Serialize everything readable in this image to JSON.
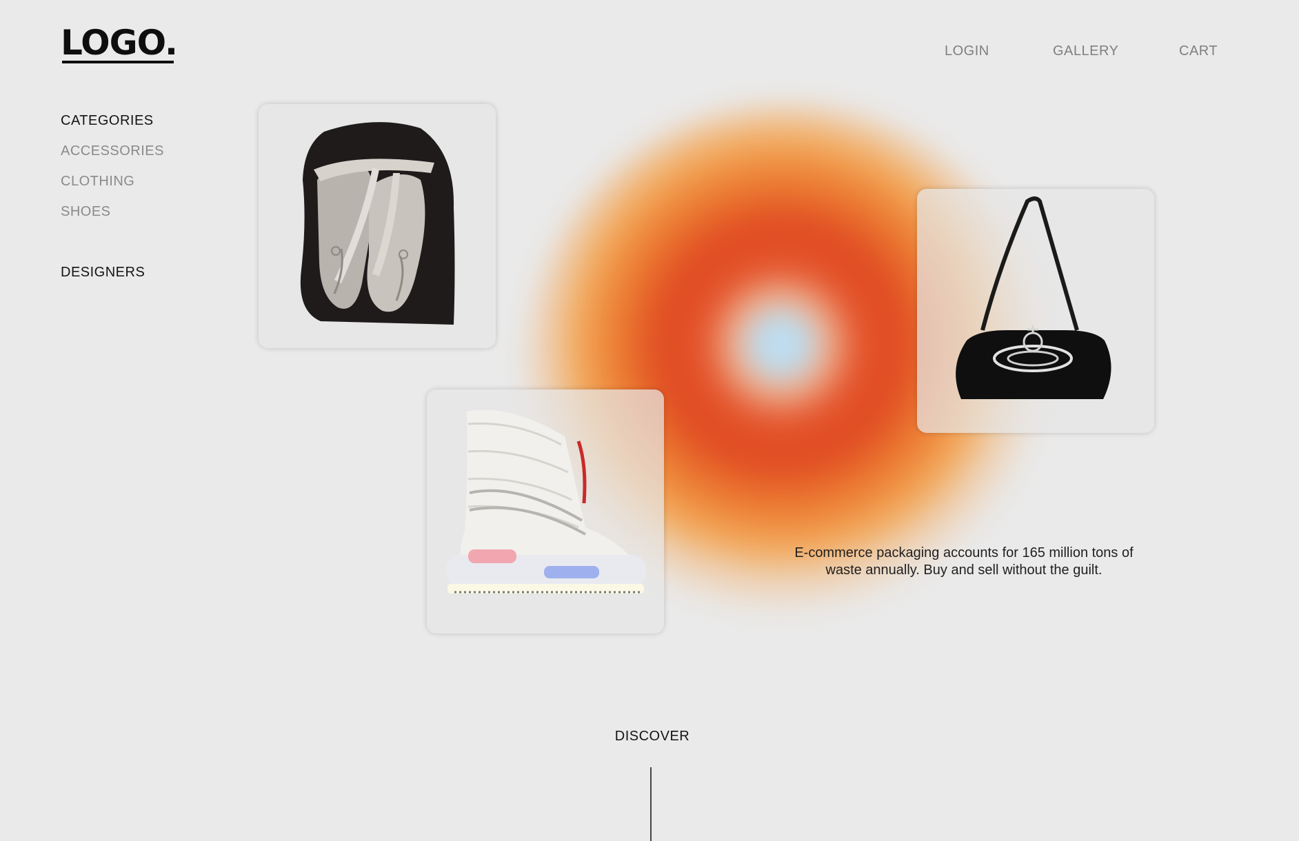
{
  "brand": {
    "logo": "LOGO."
  },
  "nav": {
    "login": "LOGIN",
    "gallery": "GALLERY",
    "cart": "CART"
  },
  "sidebar": {
    "categories_heading": "CATEGORIES",
    "items": [
      {
        "label": "ACCESSORIES"
      },
      {
        "label": "CLOTHING"
      },
      {
        "label": "SHOES"
      }
    ],
    "designers_heading": "DESIGNERS"
  },
  "products": [
    {
      "name": "ballet-pointe-shoes"
    },
    {
      "name": "black-shoulder-bag"
    },
    {
      "name": "white-puffer-boot"
    }
  ],
  "hero": {
    "tagline_line1": "E-commerce packaging accounts for 165 million tons of",
    "tagline_line2": "waste annually. Buy and sell without the guilt."
  },
  "footer": {
    "discover_label": "DISCOVER"
  },
  "colors": {
    "background": "#eaeaea",
    "blob_core": "#bfe0f2",
    "blob_red": "#e04a22",
    "blob_orange": "#ec7d32",
    "nav_text": "#7f7f7f"
  }
}
